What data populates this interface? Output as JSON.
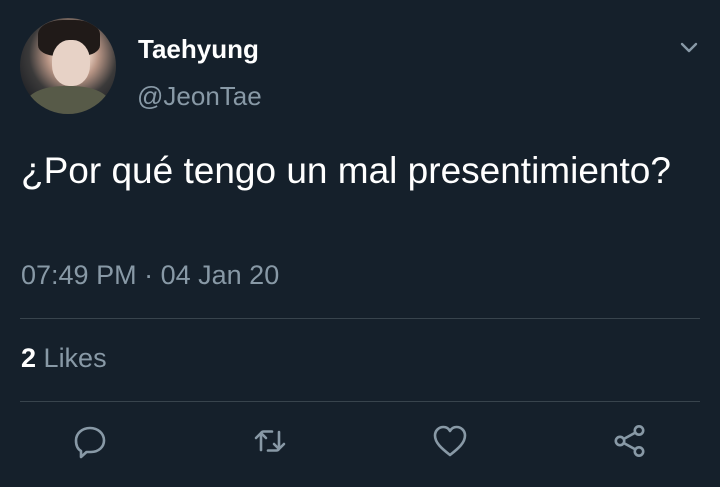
{
  "author": {
    "display_name": "Taehyung",
    "handle": "@JeonTae"
  },
  "tweet": {
    "text": "¿Por qué tengo un mal presentimiento?",
    "time": "07:49 PM",
    "separator": "·",
    "date": "04 Jan 20"
  },
  "stats": {
    "likes_count": "2",
    "likes_label": "Likes"
  },
  "actions": {
    "reply_icon": "reply-icon",
    "retweet_icon": "retweet-icon",
    "like_icon": "heart-icon",
    "share_icon": "share-icon"
  },
  "colors": {
    "background": "#15202b",
    "primary_text": "#ffffff",
    "secondary_text": "#8899a6",
    "divider": "#38444d"
  }
}
